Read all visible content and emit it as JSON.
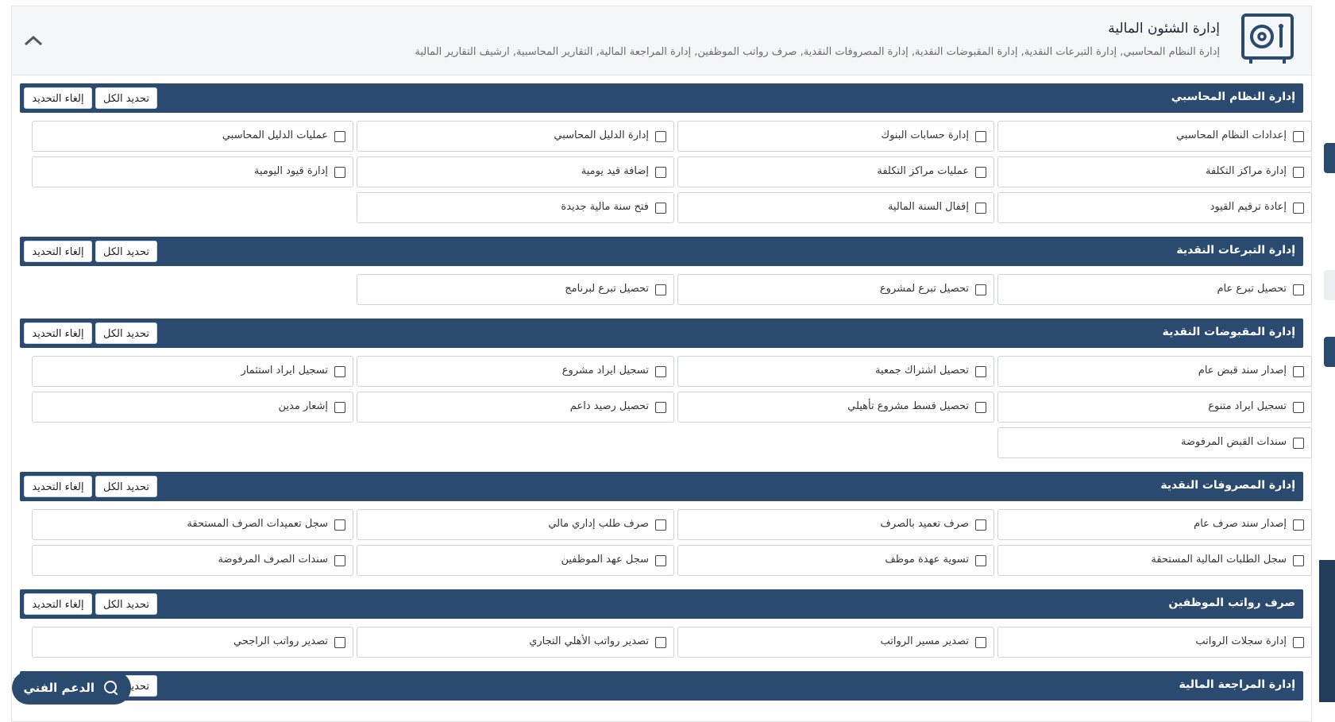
{
  "header": {
    "title": "إدارة الشئون المالية",
    "subtitle": "إدارة النظام المحاسبي, إدارة التبرعات النقدية, إدارة المقبوضات النقدية, إدارة المصروفات النقدية, صرف رواتب الموظفين, إدارة المراجعة المالية, التقارير المحاسبية, ارشيف التقارير المالية",
    "icon": "safe-icon",
    "collapse_icon": "chevron-up-icon"
  },
  "buttons": {
    "select_all": "تحديد الكل",
    "deselect": "إلغاء التحديد"
  },
  "sections": [
    {
      "title": "إدارة النظام المحاسبي",
      "items": [
        "إعدادات النظام المحاسبي",
        "إدارة حسابات البنوك",
        "إدارة الدليل المحاسبي",
        "عمليات الدليل المحاسبي",
        "إدارة مراكز التكلفة",
        "عمليات مراكز التكلفة",
        "إضافة قيد يومية",
        "إدارة قيود اليومية",
        "إعادة ترقيم القيود",
        "إقفال السنة المالية",
        "فتح سنة مالية جديدة"
      ]
    },
    {
      "title": "إدارة التبرعات النقدية",
      "items": [
        "تحصيل تبرع عام",
        "تحصيل تبرع لمشروع",
        "تحصيل تبرع لبرنامج"
      ]
    },
    {
      "title": "إدارة المقبوضات النقدية",
      "items": [
        "إصدار سند قبض عام",
        "تحصيل اشتراك جمعية",
        "تسجيل ايراد مشروع",
        "تسجيل ايراد استثمار",
        "تسجيل ايراد متنوع",
        "تحصيل قسط مشروع تأهيلي",
        "تحصيل رصيد داعم",
        "إشعار مدين",
        "سندات القبض المرفوضة"
      ]
    },
    {
      "title": "إدارة المصروفات النقدية",
      "items": [
        "إصدار سند صرف عام",
        "صرف تعميد بالصرف",
        "صرف طلب إداري مالي",
        "سجل تعميدات الصرف المستحقة",
        "سجل الطلبات المالية المستحقة",
        "تسوية عهدة موظف",
        "سجل عهد الموظفين",
        "سندات الصرف المرفوضة"
      ]
    },
    {
      "title": "صرف رواتب الموظفين",
      "items": [
        "إدارة سجلات الرواتب",
        "تصدير مسير الرواتب",
        "تصدير رواتب الأهلي التجاري",
        "تصدير رواتب الراجحي"
      ]
    },
    {
      "title": "إدارة المراجعة المالية",
      "items": []
    }
  ],
  "support": {
    "label": "الدعم الفني",
    "icon": "chat-icon"
  }
}
